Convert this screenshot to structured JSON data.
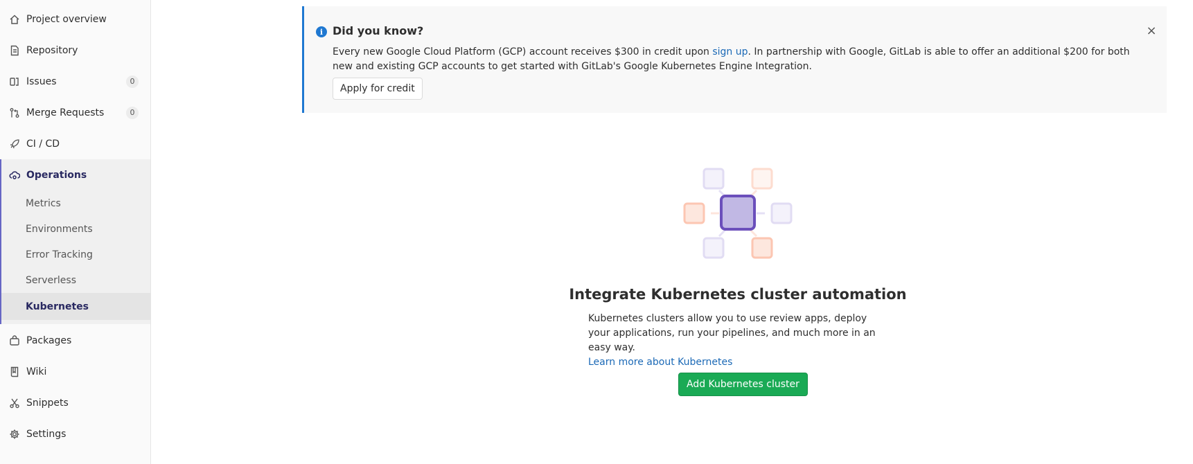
{
  "sidebar": {
    "items": [
      {
        "label": "Project overview",
        "icon": "home-icon"
      },
      {
        "label": "Repository",
        "icon": "document-icon"
      },
      {
        "label": "Issues",
        "icon": "issues-icon",
        "badge": "0"
      },
      {
        "label": "Merge Requests",
        "icon": "merge-request-icon",
        "badge": "0"
      },
      {
        "label": "CI / CD",
        "icon": "rocket-icon"
      }
    ],
    "operations": {
      "label": "Operations",
      "icon": "cloud-gear-icon",
      "subitems": [
        {
          "label": "Metrics"
        },
        {
          "label": "Environments"
        },
        {
          "label": "Error Tracking"
        },
        {
          "label": "Serverless"
        },
        {
          "label": "Kubernetes",
          "active": true
        }
      ]
    },
    "bottom_items": [
      {
        "label": "Packages",
        "icon": "package-icon"
      },
      {
        "label": "Wiki",
        "icon": "book-icon"
      },
      {
        "label": "Snippets",
        "icon": "scissors-icon"
      },
      {
        "label": "Settings",
        "icon": "gear-icon"
      }
    ]
  },
  "alert": {
    "title": "Did you know?",
    "text_part1": "Every new Google Cloud Platform (GCP) account receives $300 in credit upon ",
    "link": "sign up",
    "text_part2": ". In partnership with Google, GitLab is able to offer an additional $200 for both new and existing GCP accounts to get started with GitLab's Google Kubernetes Engine Integration.",
    "button": "Apply for credit",
    "close_symbol": "×"
  },
  "empty_state": {
    "title": "Integrate Kubernetes cluster automation",
    "text": "Kubernetes clusters allow you to use review apps, deploy your applications, run your pipelines, and much more in an easy way.",
    "link": "Learn more about Kubernetes",
    "button": "Add Kubernetes cluster"
  },
  "colors": {
    "accent": "#6666c4",
    "primary_link": "#1b69b6",
    "success": "#1aaa55",
    "info": "#1f78d1"
  }
}
